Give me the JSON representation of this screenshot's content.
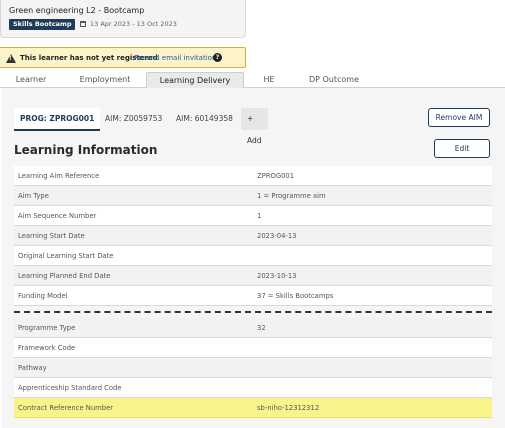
{
  "course": {
    "title": "Green engineering L2 - Bootcamp",
    "badge": "Skills Bootcamp",
    "dates": "13 Apr 2023 - 13 Oct 2023"
  },
  "warning": {
    "text": "This learner has not yet registered",
    "link": "Resend email invitation",
    "help": "?"
  },
  "main_tabs": [
    {
      "label": "Learner"
    },
    {
      "label": "Employment"
    },
    {
      "label": "Learning Delivery"
    },
    {
      "label": "HE"
    },
    {
      "label": "DP Outcome"
    }
  ],
  "aim_tabs": [
    {
      "label": "PROG: ZPROG001"
    },
    {
      "label": "AIM: Z0059753"
    },
    {
      "label": "AIM: 60149358"
    }
  ],
  "add_label": "+ Add",
  "remove_aim_label": "Remove AIM",
  "edit_label": "Edit",
  "section_title": "Learning Information",
  "rows_top": [
    {
      "label": "Learning Aim Reference",
      "value": "ZPROG001"
    },
    {
      "label": "Aim Type",
      "value": "1 = Programme aim"
    },
    {
      "label": "Aim Sequence Number",
      "value": "1"
    },
    {
      "label": "Learning Start Date",
      "value": "2023-04-13"
    },
    {
      "label": "Original Learning Start Date",
      "value": ""
    },
    {
      "label": "Learning Planned End Date",
      "value": "2023-10-13"
    },
    {
      "label": "Funding Model",
      "value": "37 = Skills Bootcamps"
    }
  ],
  "rows_bottom": [
    {
      "label": "Programme Type",
      "value": "32"
    },
    {
      "label": "Framework Code",
      "value": ""
    },
    {
      "label": "Pathway",
      "value": ""
    },
    {
      "label": "Apprenticeship Standard Code",
      "value": ""
    },
    {
      "label": "Contract Reference Number",
      "value": "sb-niho-12312312"
    }
  ]
}
